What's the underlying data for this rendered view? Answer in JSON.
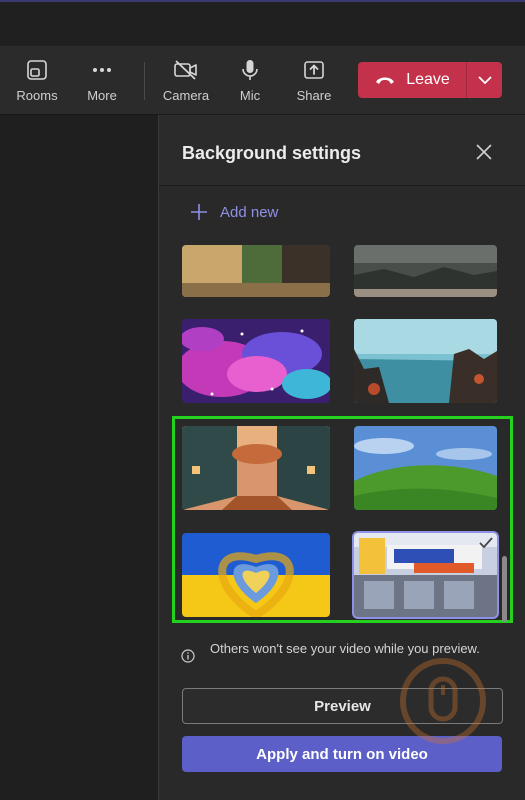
{
  "toolbar": {
    "rooms_label": "Rooms",
    "more_label": "More",
    "camera_label": "Camera",
    "mic_label": "Mic",
    "share_label": "Share",
    "leave_label": "Leave"
  },
  "panel": {
    "title": "Background settings",
    "add_new_label": "Add new",
    "backgrounds": [
      {
        "name": "fantasy-alley"
      },
      {
        "name": "desolate-landscape"
      },
      {
        "name": "galaxy-nebula"
      },
      {
        "name": "alien-lake"
      },
      {
        "name": "autumn-street"
      },
      {
        "name": "green-hill"
      },
      {
        "name": "heart-flag"
      },
      {
        "name": "storefront",
        "selected": true
      }
    ],
    "info_text": "Others won't see your video while you preview.",
    "preview_label": "Preview",
    "apply_label": "Apply and turn on video"
  },
  "colors": {
    "accent": "#5b5fc7",
    "leave": "#c4314b",
    "highlight": "#25d11f"
  }
}
